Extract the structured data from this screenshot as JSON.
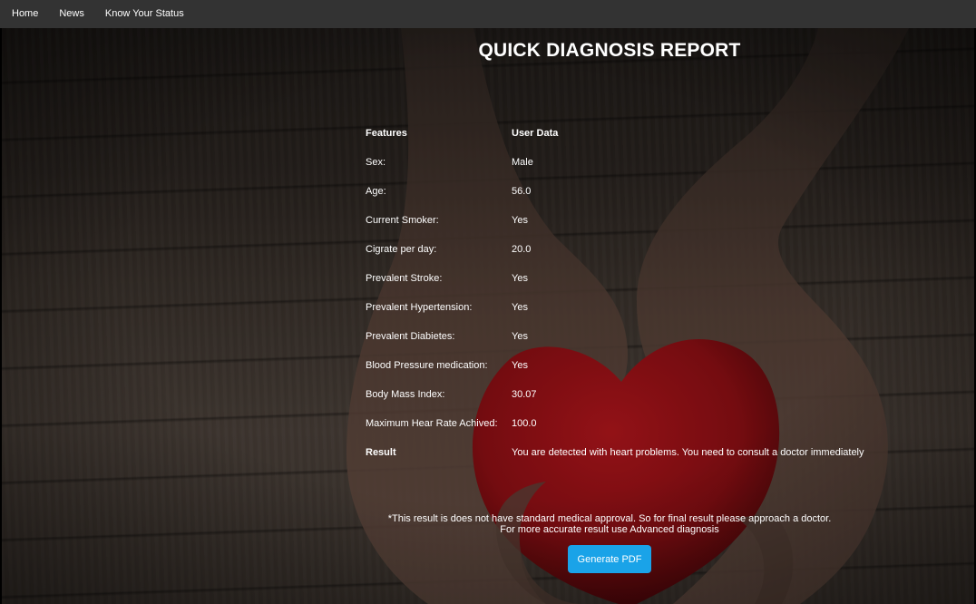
{
  "nav": {
    "items": [
      {
        "label": "Home"
      },
      {
        "label": "News"
      },
      {
        "label": "Know Your Status"
      }
    ]
  },
  "page_title": "QUICK DIAGNOSIS REPORT",
  "report": {
    "header": {
      "feature": "Features",
      "value": "User Data"
    },
    "rows": [
      {
        "feature": "Sex:",
        "value": "Male"
      },
      {
        "feature": "Age:",
        "value": "56.0"
      },
      {
        "feature": "Current Smoker:",
        "value": "Yes"
      },
      {
        "feature": "Cigrate per day:",
        "value": "20.0"
      },
      {
        "feature": "Prevalent Stroke:",
        "value": "Yes"
      },
      {
        "feature": "Prevalent Hypertension:",
        "value": "Yes"
      },
      {
        "feature": "Prevalent Diabietes:",
        "value": "Yes"
      },
      {
        "feature": "Blood Pressure medication:",
        "value": "Yes"
      },
      {
        "feature": "Body Mass Index:",
        "value": "30.07"
      },
      {
        "feature": "Maximum Hear Rate Achived:",
        "value": "100.0"
      }
    ],
    "result": {
      "feature": "Result",
      "value": "You are detected with heart problems. You need to consult a doctor immediately"
    }
  },
  "disclaimer": {
    "line1": "*This result is does not have standard medical approval. So for final result please approach a doctor.",
    "line2": "For more accurate result use Advanced diagnosis"
  },
  "generate_pdf_label": "Generate PDF",
  "colors": {
    "navbar": "#333333",
    "button": "#1aa3e8",
    "heart": "#8e0f14"
  }
}
